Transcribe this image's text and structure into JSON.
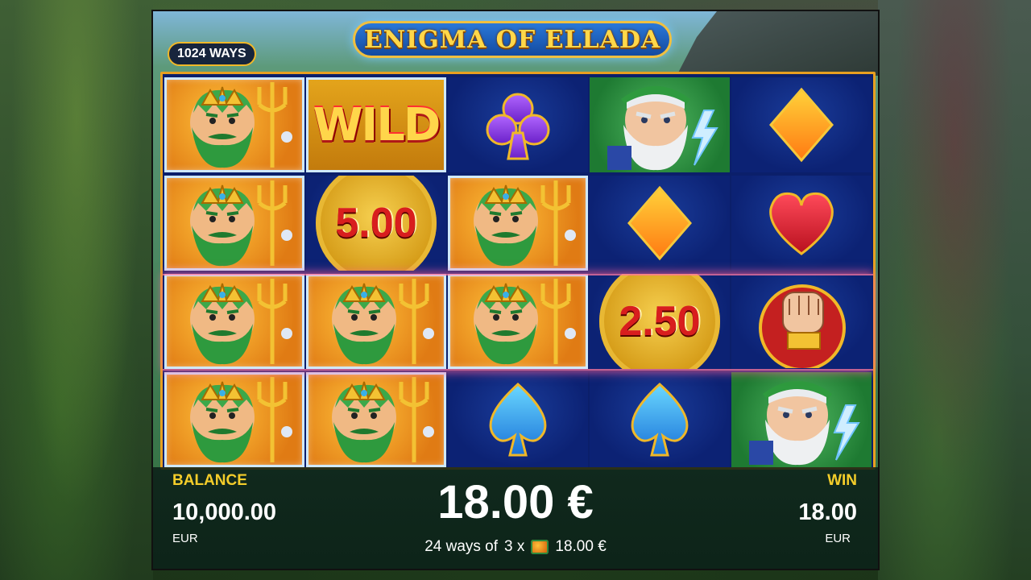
{
  "game": {
    "title": "ENIGMA OF ELLADA",
    "ways_badge": "1024 WAYS"
  },
  "reels": [
    [
      {
        "symbol": "poseidon"
      },
      {
        "symbol": "poseidon"
      },
      {
        "symbol": "poseidon"
      },
      {
        "symbol": "poseidon"
      }
    ],
    [
      {
        "symbol": "wild",
        "label": "WILD"
      },
      {
        "symbol": "coin",
        "label": "5.00"
      },
      {
        "symbol": "poseidon"
      },
      {
        "symbol": "poseidon"
      }
    ],
    [
      {
        "symbol": "club"
      },
      {
        "symbol": "poseidon"
      },
      {
        "symbol": "poseidon"
      },
      {
        "symbol": "spade"
      }
    ],
    [
      {
        "symbol": "zeus"
      },
      {
        "symbol": "diamond"
      },
      {
        "symbol": "coin",
        "label": "2.50"
      },
      {
        "symbol": "spade"
      }
    ],
    [
      {
        "symbol": "diamond"
      },
      {
        "symbol": "heart"
      },
      {
        "symbol": "fist"
      },
      {
        "symbol": "zeus"
      }
    ]
  ],
  "bottom": {
    "balance_label": "BALANCE",
    "balance_value": "10,000.00",
    "balance_currency": "EUR",
    "win_amount_big": "18.00 €",
    "ways_prefix": "24 ways of",
    "ways_multiplier": "3 x",
    "ways_symbol": "poseidon",
    "ways_amount": "18.00 €",
    "win_label": "WIN",
    "win_value": "18.00",
    "win_currency": "EUR"
  },
  "colors": {
    "accent_gold": "#f4cd2a",
    "reel_blue": "#0c2274",
    "frame_orange": "#e8a020"
  }
}
